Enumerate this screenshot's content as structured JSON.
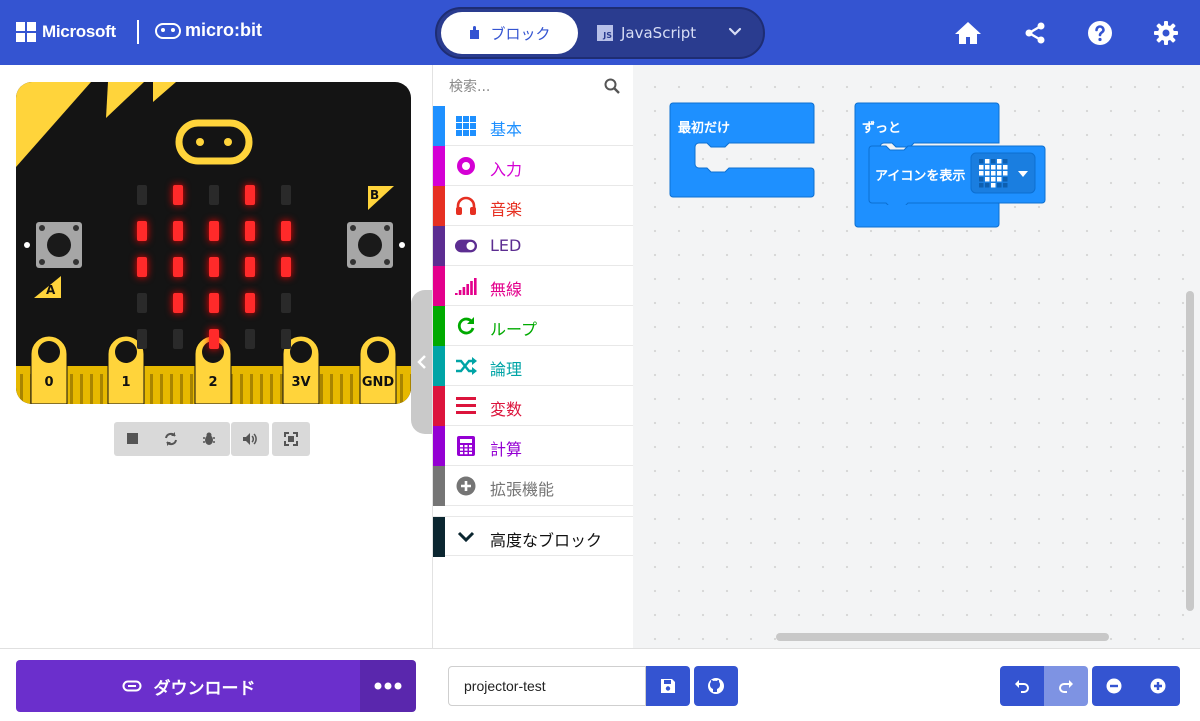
{
  "header": {
    "microsoft_label": "Microsoft",
    "microbit_label": "micro:bit",
    "tabs": [
      {
        "label": "ブロック",
        "active": true
      },
      {
        "label": "JavaScript",
        "active": false
      }
    ],
    "icons": [
      "home-icon",
      "share-icon",
      "help-icon",
      "settings-icon"
    ]
  },
  "simulator": {
    "pins": [
      "0",
      "1",
      "2",
      "3V",
      "GND"
    ],
    "button_a_label": "A",
    "button_b_label": "B",
    "led_matrix": [
      [
        0,
        1,
        0,
        1,
        0
      ],
      [
        1,
        1,
        1,
        1,
        1
      ],
      [
        1,
        1,
        1,
        1,
        1
      ],
      [
        0,
        1,
        1,
        1,
        0
      ],
      [
        0,
        0,
        1,
        0,
        0
      ]
    ],
    "controls": [
      "stop-icon",
      "restart-icon",
      "debug-icon",
      "sound-icon",
      "fullscreen-icon"
    ]
  },
  "toolbox": {
    "search_placeholder": "検索...",
    "categories": [
      {
        "label": "基本",
        "color": "#1e90ff",
        "icon": "grid-icon"
      },
      {
        "label": "入力",
        "color": "#d400d4",
        "icon": "input-circle-icon"
      },
      {
        "label": "音楽",
        "color": "#e63022",
        "icon": "headphones-icon"
      },
      {
        "label": "LED",
        "color": "#5c2d91",
        "icon": "toggle-icon"
      },
      {
        "label": "無線",
        "color": "#e3008c",
        "icon": "signal-bars-icon"
      },
      {
        "label": "ループ",
        "color": "#00aa00",
        "icon": "loop-icon"
      },
      {
        "label": "論理",
        "color": "#00a4a6",
        "icon": "shuffle-icon"
      },
      {
        "label": "変数",
        "color": "#dc143c",
        "icon": "list-lines-icon"
      },
      {
        "label": "計算",
        "color": "#9400d3",
        "icon": "calculator-icon"
      },
      {
        "label": "拡張機能",
        "color": "#757575",
        "icon": "plus-circle-icon"
      }
    ],
    "advanced": {
      "label": "高度なブロック",
      "color": "#0b2630",
      "icon": "chevron-down-icon"
    }
  },
  "workspace": {
    "block_start": {
      "label": "最初だけ",
      "color": "#1e90ff"
    },
    "block_forever": {
      "label": "ずっと",
      "color": "#1e90ff"
    },
    "block_show_icon": {
      "label": "アイコンを表示",
      "color": "#1e90ff"
    }
  },
  "footer": {
    "download_label": "ダウンロード",
    "project_name": "projector-test",
    "download_color": "#6b2fcc"
  }
}
